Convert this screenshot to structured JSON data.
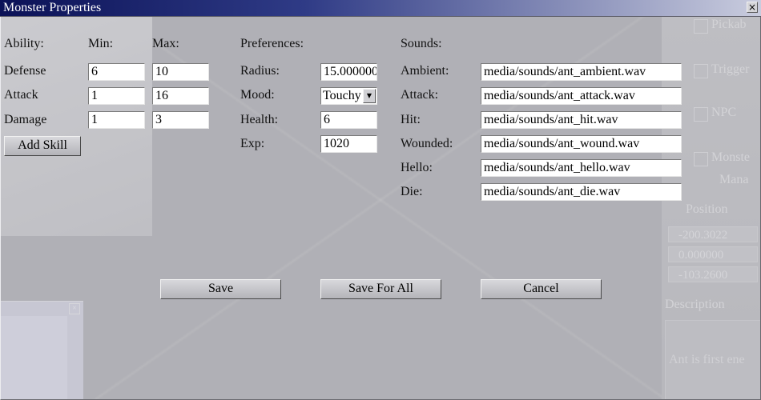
{
  "window": {
    "title": "Monster Properties",
    "close_glyph": "×"
  },
  "background": {
    "right_panel": {
      "pickable": "Pickab",
      "trigger": "Trigger",
      "npc": "NPC",
      "monster": "Monste",
      "manage": "Mana",
      "position": "Position",
      "pos_x": "-200.3022",
      "pos_y": "0.000000",
      "pos_z": "-103.2600",
      "description_label": "Description",
      "description_text": "Ant is first ene"
    },
    "mini_close_glyph": "×"
  },
  "ability": {
    "header": "Ability:",
    "min_header": "Min:",
    "max_header": "Max:",
    "rows": [
      {
        "label": "Defense",
        "min": "6",
        "max": "10"
      },
      {
        "label": "Attack",
        "min": "1",
        "max": "16"
      },
      {
        "label": "Damage",
        "min": "1",
        "max": "3"
      }
    ],
    "add_skill": "Add Skill"
  },
  "preferences": {
    "header": "Preferences:",
    "radius_label": "Radius:",
    "radius_value": "15.000000",
    "mood_label": "Mood:",
    "mood_value": "Touchy",
    "health_label": "Health:",
    "health_value": "6",
    "exp_label": "Exp:",
    "exp_value": "1020"
  },
  "sounds": {
    "header": "Sounds:",
    "rows": [
      {
        "label": "Ambient:",
        "value": "media/sounds/ant_ambient.wav"
      },
      {
        "label": "Attack:",
        "value": "media/sounds/ant_attack.wav"
      },
      {
        "label": "Hit:",
        "value": "media/sounds/ant_hit.wav"
      },
      {
        "label": "Wounded:",
        "value": "media/sounds/ant_wound.wav"
      },
      {
        "label": "Hello:",
        "value": "media/sounds/ant_hello.wav"
      },
      {
        "label": "Die:",
        "value": "media/sounds/ant_die.wav"
      }
    ]
  },
  "actions": {
    "save": "Save",
    "save_for_all": "Save For All",
    "cancel": "Cancel"
  },
  "icons": {
    "close": "close-icon",
    "dropdown": "chevron-down-icon"
  }
}
